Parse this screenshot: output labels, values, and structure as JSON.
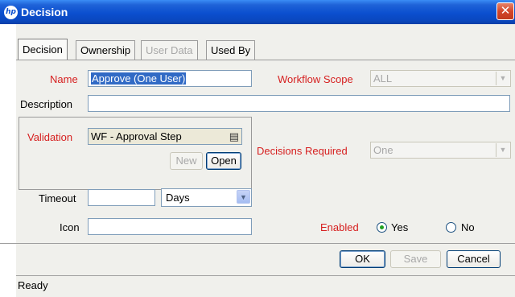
{
  "window": {
    "title": "Decision",
    "app_icon": "hp",
    "close_glyph": "✕"
  },
  "tabs": [
    {
      "label": "Decision",
      "state": "active"
    },
    {
      "label": "Ownership",
      "state": "enabled"
    },
    {
      "label": "User Data",
      "state": "disabled"
    },
    {
      "label": "Used By",
      "state": "enabled"
    }
  ],
  "form": {
    "name_label": "Name",
    "name_value": "Approve (One User)",
    "workflow_scope_label": "Workflow Scope",
    "workflow_scope_value": "ALL",
    "description_label": "Description",
    "description_value": "",
    "validation_label": "Validation",
    "validation_value": "WF - Approval Step",
    "validation_icon": "list-icon",
    "new_label": "New",
    "open_label": "Open",
    "decisions_required_label": "Decisions Required",
    "decisions_required_value": "One",
    "timeout_label": "Timeout",
    "timeout_value": "",
    "timeout_unit_value": "Days",
    "icon_label": "Icon",
    "icon_value": "",
    "enabled_label": "Enabled",
    "enabled_yes_label": "Yes",
    "enabled_no_label": "No",
    "enabled_selected": "Yes"
  },
  "buttons": {
    "ok_label": "OK",
    "save_label": "Save",
    "cancel_label": "Cancel"
  },
  "status": {
    "text": "Ready"
  },
  "colors": {
    "required_label": "#d61f1f",
    "titlebar": "#0b4fcf",
    "selection": "#316ac5"
  }
}
